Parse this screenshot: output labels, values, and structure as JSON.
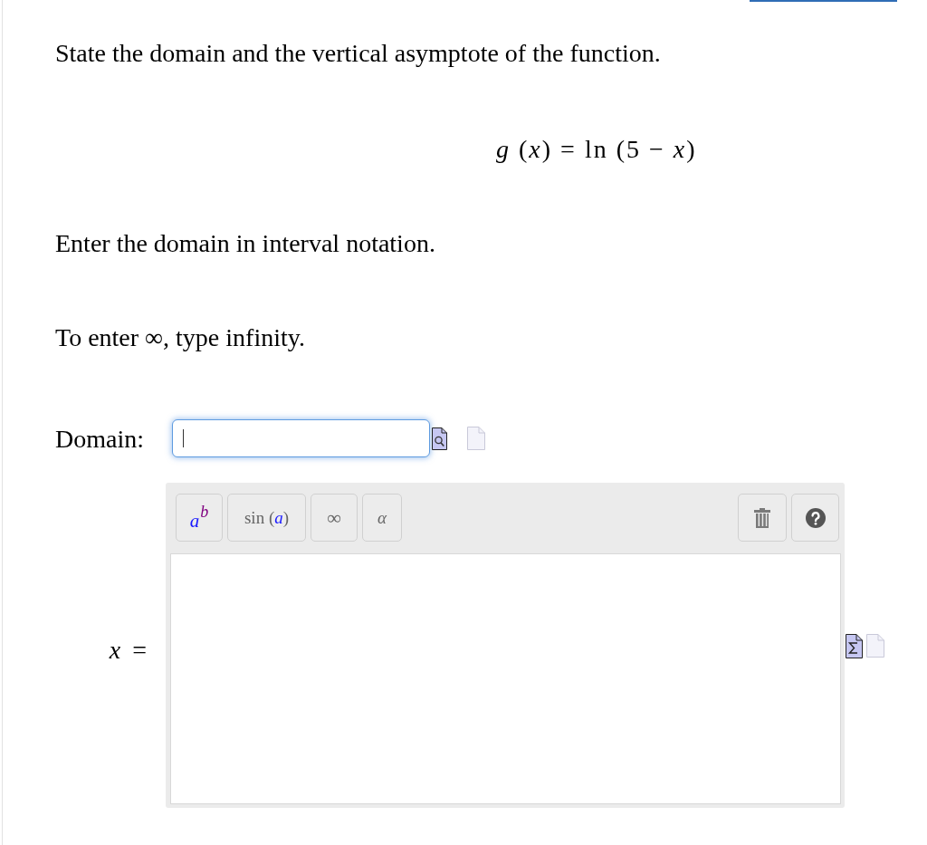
{
  "question": {
    "prompt": "State the domain and the vertical asymptote of the function.",
    "formula": "*g* (*x*) = ln (5 − *x*)"
  },
  "instructions": [
    "Enter the domain in interval notation.",
    "To enter ∞, type infinity."
  ],
  "domain_field": {
    "label": "Domain:",
    "focused": true
  },
  "equation_editor": {
    "toolbar": [
      {
        "kind": "power",
        "base": "a",
        "exponent": "b"
      },
      {
        "kind": "function",
        "label": "sin (*a*)"
      },
      {
        "kind": "symbol",
        "label": "∞"
      },
      {
        "kind": "symbol",
        "label": "α"
      }
    ],
    "answer_label": "*x* ="
  }
}
